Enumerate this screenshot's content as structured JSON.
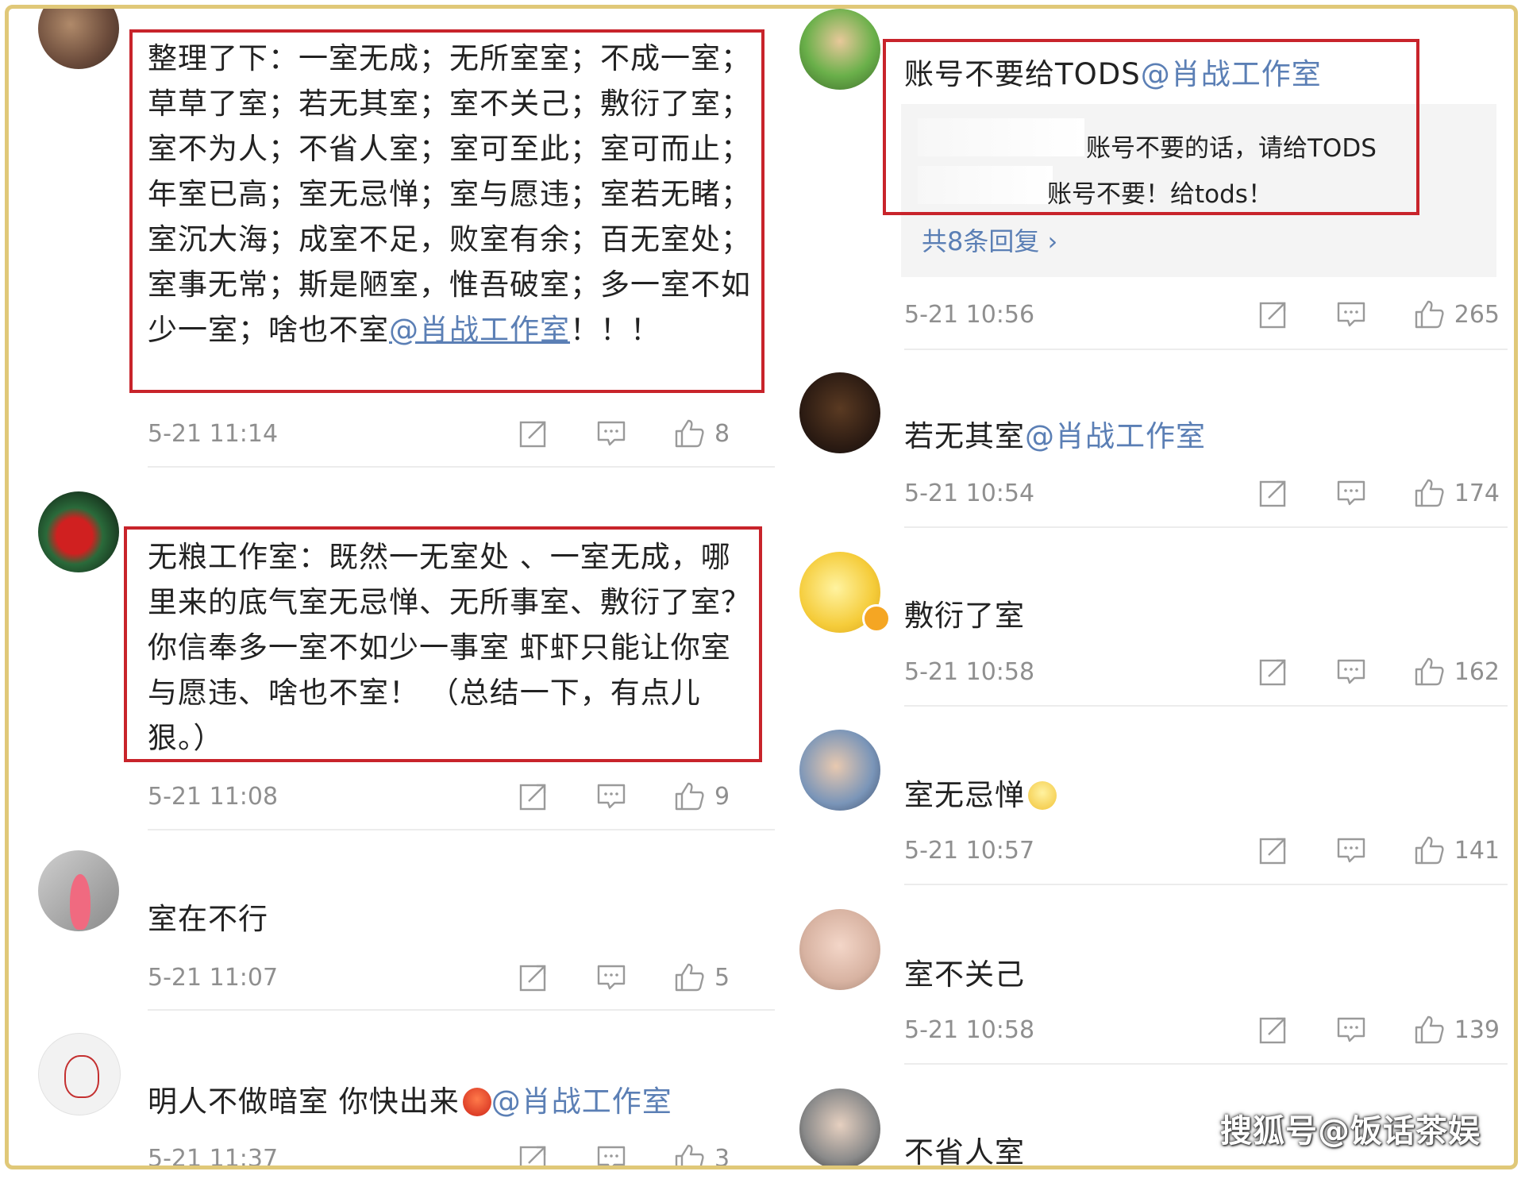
{
  "left_comments": [
    {
      "text": "整理了下：一室无成；无所室室；不成一室；草草了室；若无其室；室不关己；敷衍了室；室不为人；不省人室；室可至此；室可而止；年室已高；室无忌惮；室与愿违；室若无睹；室沉大海；成室不足，败室有余；百无室处；室事无常；斯是陋室，惟吾破室；多一室不如少一室；啥也不室",
      "mention": "@肖战工作室",
      "suffix": "！！！",
      "time": "5-21 11:14",
      "likes": "8"
    },
    {
      "text": "无粮工作室：既然一无室处 、一室无成，哪里来的底气室无忌惮、无所事室、敷衍了室？你信奉多一室不如少一事室  虾虾只能让你室与愿违、啥也不室！ （总结一下，有点儿狠。）",
      "time": "5-21 11:08",
      "likes": "9"
    },
    {
      "text": "室在不行",
      "time": "5-21 11:07",
      "likes": "5"
    },
    {
      "text": "明人不做暗室 你快出来",
      "mention": "@肖战工作室",
      "time": "5-21 11:37",
      "likes": "3"
    }
  ],
  "right_comments": [
    {
      "text": "账号不要给TODS",
      "mention": "@肖战工作室",
      "replies": [
        "账号不要的话，请给TODS",
        "账号不要！给tods！"
      ],
      "more_replies": "共8条回复 ›",
      "time": "5-21 10:56",
      "likes": "265"
    },
    {
      "text": "若无其室",
      "mention": "@肖战工作室",
      "time": "5-21 10:54",
      "likes": "174"
    },
    {
      "text": "敷衍了室",
      "time": "5-21 10:58",
      "likes": "162"
    },
    {
      "text": "室无忌惮",
      "time": "5-21 10:57",
      "likes": "141"
    },
    {
      "text": "室不关己",
      "time": "5-21 10:58",
      "likes": "139"
    },
    {
      "text": "不省人室"
    }
  ],
  "watermark": "搜狐号@饭话茶娱",
  "icons": {
    "repost": "repost-icon",
    "comment": "comment-icon",
    "like": "like-icon"
  },
  "colors": {
    "highlight_box": "#c8242b",
    "link": "#5b7fb5",
    "frame": "#e0c878"
  }
}
